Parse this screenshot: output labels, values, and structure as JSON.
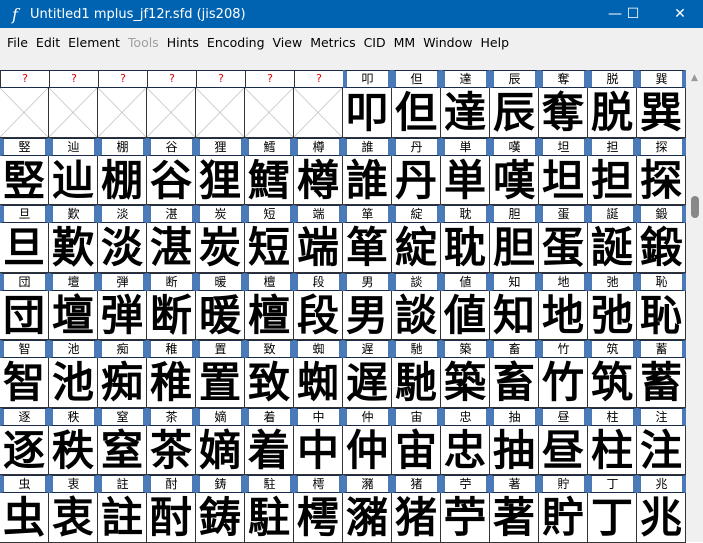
{
  "window": {
    "title": "Untitled1  mplus_jf12r.sfd (jis208)",
    "minimize": "—",
    "maximize": "☐",
    "close": "✕"
  },
  "menu": [
    "File",
    "Edit",
    "Element",
    "Tools",
    "Hints",
    "Encoding",
    "View",
    "Metrics",
    "CID",
    "MM",
    "Window",
    "Help"
  ],
  "menu_disabled": [
    "Tools"
  ],
  "grid": [
    [
      "?",
      "?",
      "?",
      "?",
      "?",
      "?",
      "?",
      "叩",
      "但",
      "達",
      "辰",
      "奪",
      "脱",
      "巽"
    ],
    [
      "竪",
      "辿",
      "棚",
      "谷",
      "狸",
      "鱈",
      "樽",
      "誰",
      "丹",
      "単",
      "嘆",
      "坦",
      "担",
      "探"
    ],
    [
      "旦",
      "歎",
      "淡",
      "湛",
      "炭",
      "短",
      "端",
      "箪",
      "綻",
      "耽",
      "胆",
      "蛋",
      "誕",
      "鍛"
    ],
    [
      "団",
      "壇",
      "弾",
      "断",
      "暖",
      "檀",
      "段",
      "男",
      "談",
      "値",
      "知",
      "地",
      "弛",
      "恥"
    ],
    [
      "智",
      "池",
      "痴",
      "稚",
      "置",
      "致",
      "蜘",
      "遅",
      "馳",
      "築",
      "畜",
      "竹",
      "筑",
      "蓄"
    ],
    [
      "逐",
      "秩",
      "窒",
      "茶",
      "嫡",
      "着",
      "中",
      "仲",
      "宙",
      "忠",
      "抽",
      "昼",
      "柱",
      "注"
    ],
    [
      "虫",
      "衷",
      "註",
      "酎",
      "鋳",
      "駐",
      "樗",
      "瀦",
      "猪",
      "苧",
      "著",
      "貯",
      "丁",
      "兆"
    ]
  ]
}
